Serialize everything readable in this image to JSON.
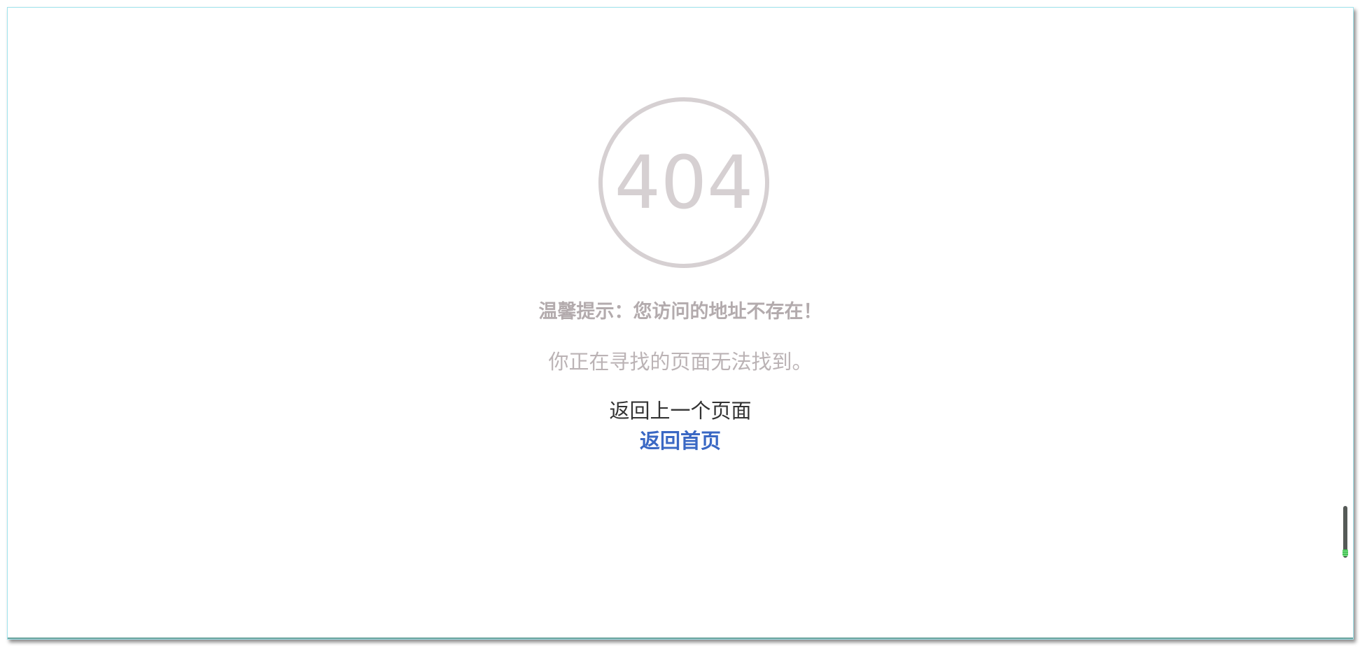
{
  "error": {
    "code": "404",
    "headline": "温馨提示：您访问的地址不存在！",
    "message": "你正在寻找的页面无法找到。"
  },
  "links": {
    "back": "返回上一个页面",
    "home": "返回首页"
  },
  "colors": {
    "badge": "#d6d0d2",
    "headline": "#b3abad",
    "message": "#bbb3b5",
    "back_link": "#333333",
    "home_link": "#3a68c4",
    "window_border": "#9fe3ec"
  }
}
